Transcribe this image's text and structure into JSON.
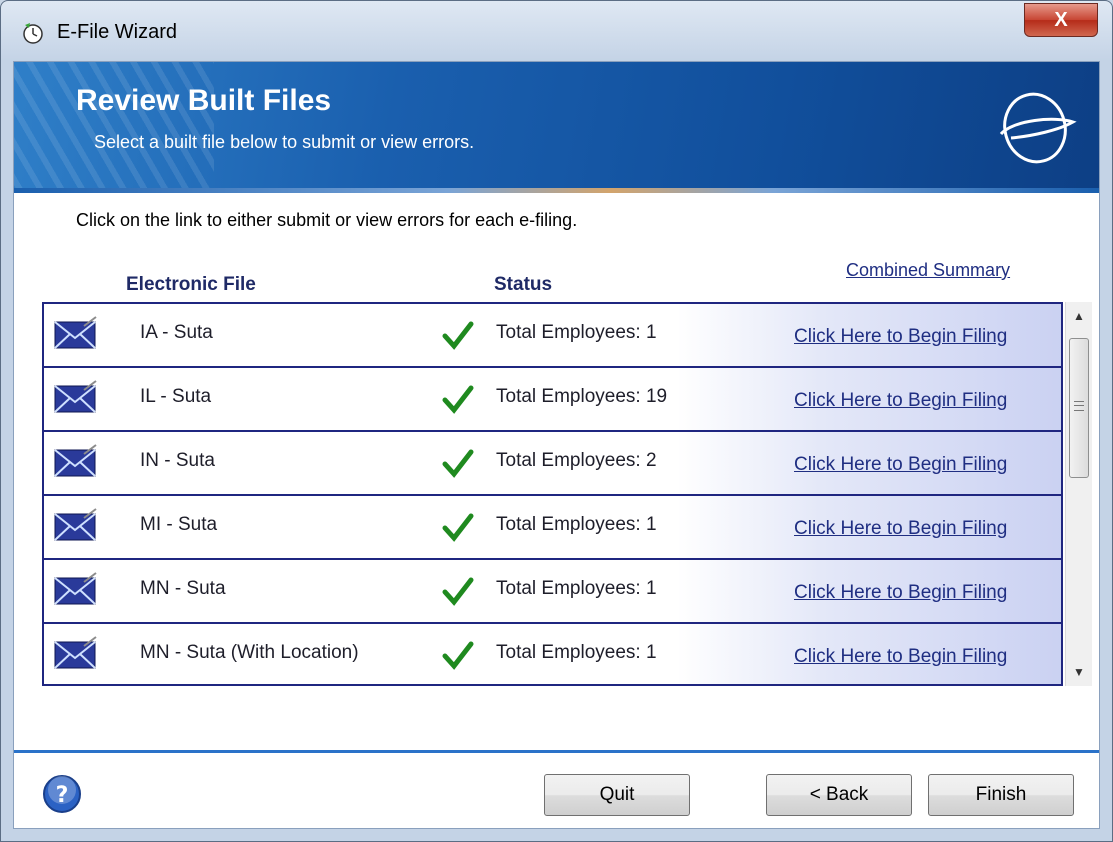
{
  "window": {
    "title": "E-File Wizard",
    "close_label": "X"
  },
  "banner": {
    "title": "Review Built Files",
    "subtitle": "Select a built file below to submit or view errors."
  },
  "instructions": "Click on the link to either submit or view errors for each e-filing.",
  "combined_summary": "Combined Summary",
  "columns": {
    "file": "Electronic File",
    "status": "Status"
  },
  "rows": [
    {
      "file": "IA - Suta",
      "status": "Total Employees: 1",
      "link": "Click Here to Begin Filing"
    },
    {
      "file": "IL - Suta",
      "status": "Total Employees: 19",
      "link": "Click Here to Begin Filing"
    },
    {
      "file": "IN - Suta",
      "status": "Total Employees: 2",
      "link": "Click Here to Begin Filing"
    },
    {
      "file": "MI - Suta",
      "status": "Total Employees: 1",
      "link": "Click Here to Begin Filing"
    },
    {
      "file": "MN - Suta",
      "status": "Total Employees: 1",
      "link": "Click Here to Begin Filing"
    },
    {
      "file": "MN - Suta (With Location)",
      "status": "Total Employees: 1",
      "link": "Click Here to Begin Filing"
    }
  ],
  "buttons": {
    "quit": "Quit",
    "back": "< Back",
    "finish": "Finish"
  },
  "colors": {
    "banner": "#1a5fae",
    "link": "#1f2e82",
    "row_border": "#1f2680",
    "check": "#1f8a1f"
  }
}
